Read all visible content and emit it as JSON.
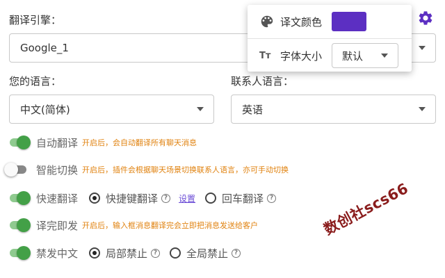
{
  "engine": {
    "label": "翻译引擎：",
    "value": "Google_1"
  },
  "your_language": {
    "label": "您的语言：",
    "value": "中文(简体)"
  },
  "contact_language": {
    "label": "联系人语言：",
    "value": "英语"
  },
  "toggles": [
    {
      "label": "自动翻译",
      "state": "on",
      "hint": "开启后，会自动翻译所有聊天消息"
    },
    {
      "label": "智能切换",
      "state": "off",
      "hint": "开启后，插件会根据聊天场景切换联系人语言，亦可手动切换"
    },
    {
      "label": "快速翻译",
      "state": "on",
      "options": {
        "a": "快捷键翻译",
        "selected": "快捷键翻译",
        "link": "设置",
        "b": "回车翻译"
      }
    },
    {
      "label": "译完即发",
      "state": "on",
      "hint": "开启后，输入框消息翻译完会立即把消息发送给客户"
    },
    {
      "label": "禁发中文",
      "state": "on",
      "options": {
        "a": "局部禁止",
        "selected": "局部禁止",
        "b": "全局禁止"
      }
    }
  ],
  "popup": {
    "color_label": "译文颜色",
    "color_value": "#5c2fc2",
    "font_label": "字体大小",
    "font_value": "默认",
    "palette_icon": "palette-icon",
    "font_icon": "text-size-icon"
  },
  "settings_icon": "gear-icon",
  "colors": {
    "accent": "#5c2fc2",
    "toggle_on": "#43a047",
    "hint": "#e0820f",
    "link": "#6a4bd6"
  },
  "watermark": "数创社scs66"
}
